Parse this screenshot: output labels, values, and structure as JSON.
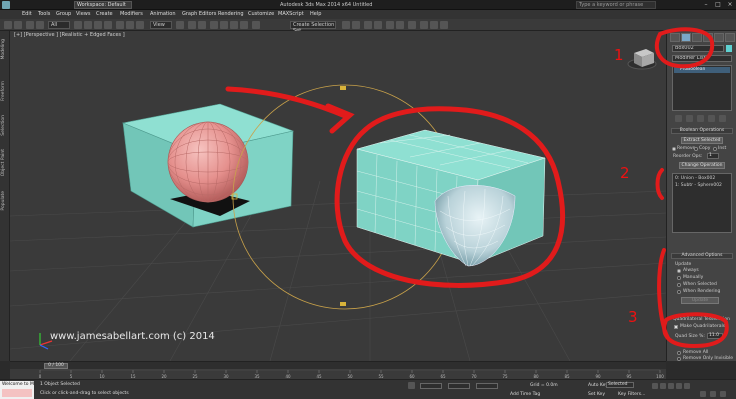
{
  "titlebar": {
    "workspace": "Workspace: Default",
    "title": "Autodesk 3ds Max 2014 x64     Untitled",
    "search_placeholder": "Type a keyword or phrase"
  },
  "menu": [
    "Edit",
    "Tools",
    "Group",
    "Views",
    "Create",
    "Modifiers",
    "Animation",
    "Graph Editors",
    "Rendering",
    "Customize",
    "MAXScript",
    "Help"
  ],
  "toolbar": {
    "filter": "All",
    "view": "View",
    "selection_set": "Create Selection Set"
  },
  "left_tabs": [
    "Modeling",
    "Freeform",
    "Selection",
    "Object Paint",
    "Populate"
  ],
  "viewport": {
    "label": "[+] [Perspective ] [Realistic + Edged Faces ]",
    "watermark": "www.jamesabellart.com (c) 2014"
  },
  "panel": {
    "object_name": "Box002",
    "modifier_list": "Modifier List",
    "stack_item": "ProBoolean",
    "rollout_ops": "Boolean Operations",
    "extract_selected": "Extract Selected",
    "radio_remove": "Remove",
    "radio_copy": "Copy",
    "radio_inst": "Inst",
    "reorder_ops": "Reorder Ops:",
    "reorder_value": "1",
    "change_operation": "Change Operation",
    "operands": [
      "0: Union - Box002",
      "1: Subtr - Sphere002"
    ],
    "rollout_advanced": "Advanced Options",
    "updates": "Update",
    "update_options": [
      "Always",
      "Manually",
      "When Selected",
      "When Rendering"
    ],
    "update_button": "Update",
    "quad_title": "Quadrilateral Tessellation",
    "make_quads": "Make Quadrilaterals",
    "quad_size_label": "Quad Size %:",
    "quad_size_value": "11.0",
    "remove_all": "Remove All",
    "remove_invisible": "Remove Only Invisible",
    "no_edge_removal": "No Edge Removal"
  },
  "timeline": {
    "frame": "0 / 100",
    "ticks": [
      "0",
      "5",
      "10",
      "15",
      "20",
      "25",
      "30",
      "35",
      "40",
      "45",
      "50",
      "55",
      "60",
      "65",
      "70",
      "75",
      "80",
      "85",
      "90",
      "95",
      "100"
    ]
  },
  "status": {
    "selected": "1 Object Selected",
    "prompt": "Click or click-and-drag to select objects",
    "grid": "Grid = 0.0m",
    "auto_key": "Auto Key",
    "selected_mode": "Selected",
    "set_key": "Set Key",
    "key_filters": "Key Filters...",
    "add_time_tag": "Add Time Tag",
    "maxscript_label": "Welcome to M"
  },
  "annotations": {
    "n1": "1",
    "n2": "2",
    "n3": "3",
    "annotation_color": "#e11b1b"
  },
  "colors": {
    "box": "#7fd1c4",
    "sphere": "#e99a97",
    "viewport_bg": "#3a3a3a"
  }
}
